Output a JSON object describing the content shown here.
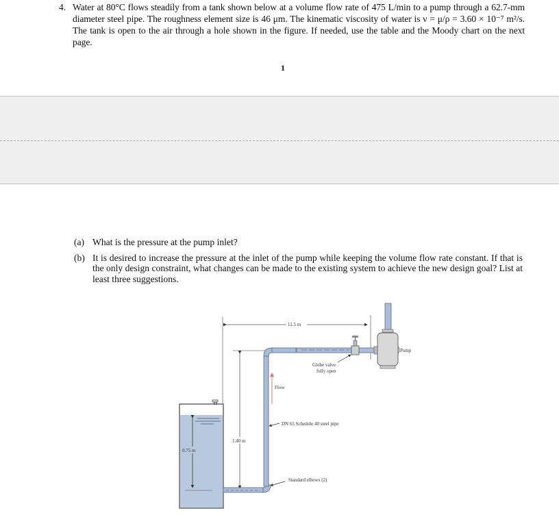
{
  "problem": {
    "number": "4.",
    "text": "Water at 80°C flows steadily from a tank shown below at a volume flow rate of 475 L/min to a pump through a 62.7-mm diameter steel pipe. The roughness element size is 46 μm. The kinematic viscosity of water is ν = μ/ρ = 3.60 × 10⁻⁷ m²/s. The tank is open to the air through a hole shown in the figure. If needed, use the table and the Moody chart on the next page."
  },
  "page_number": "1",
  "parts": [
    {
      "label": "(a)",
      "text": "What is the pressure at the pump inlet?"
    },
    {
      "label": "(b)",
      "text": "It is desired to increase the pressure at the inlet of the pump while keeping the volume flow rate constant. If that is the only design constraint, what changes can be made to the existing system to achieve the new design goal? List at least three suggestions."
    }
  ],
  "figure": {
    "labels": {
      "horizontal_length": "11.5 m",
      "pump": "Pump",
      "globe_valve_line1": "Globe valve",
      "globe_valve_line2": "fully open",
      "flow": "Flow",
      "pipe": "DN 65 Schedule 40 steel pipe",
      "elevation": "1.40 m",
      "water_depth": "0.75 m",
      "elbows": "Standard elbows (2)"
    },
    "colors": {
      "water": "#b8c8de",
      "pipe": "#a9bddb",
      "pump_body": "#d8d8d8",
      "flow_arrow": "#e07a5f",
      "outline": "#555555"
    }
  }
}
